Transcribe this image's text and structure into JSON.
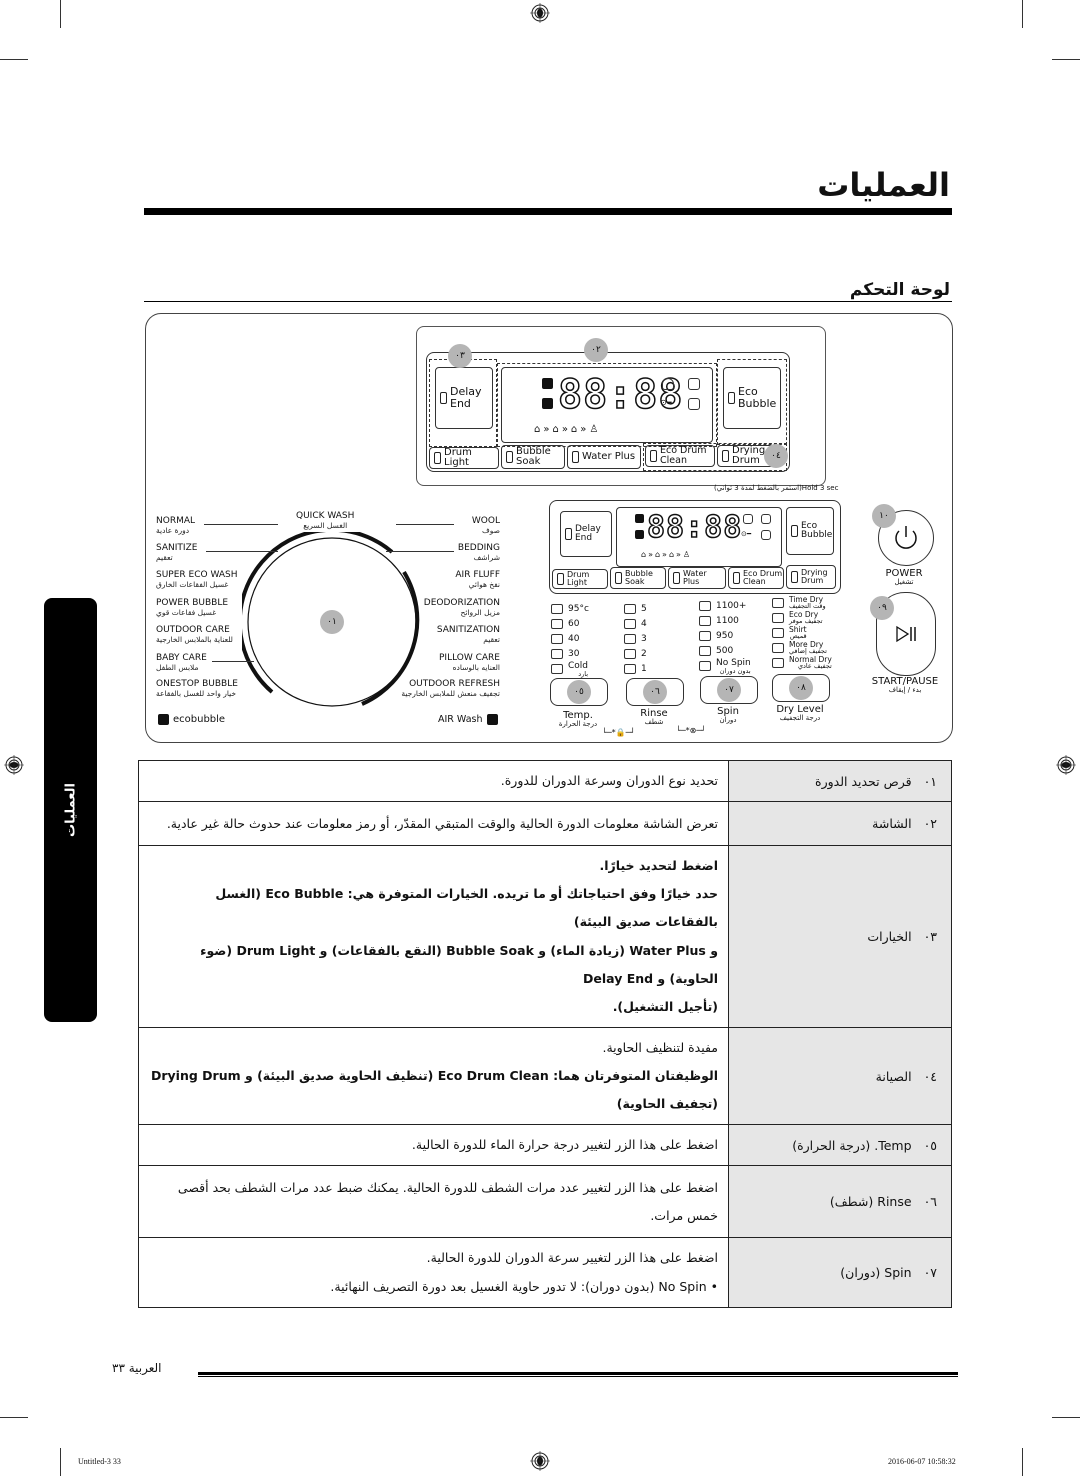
{
  "header": {
    "title": "العمليات",
    "section_title": "لوحة التحكم"
  },
  "side_tab": {
    "label": "العمليات"
  },
  "panel": {
    "upper_display": {
      "digits": "88:88",
      "buttons": {
        "delay_end": "Delay End",
        "eco_bubble": "Eco Bubble",
        "drum_light": "Drum Light",
        "bubble_soak": "Bubble Soak",
        "water_plus": "Water Plus",
        "eco_drum_clean": "Eco Drum Clean",
        "drying_drum": "Drying Drum"
      },
      "badges": {
        "b02": "٠٢",
        "b03": "٠٣",
        "b04": "٠٤"
      }
    },
    "hold_note": "(استمر بالضغط لمدة 3 ثواني)Hold 3 sec",
    "dial": {
      "badge": "٠١",
      "top": {
        "en": "QUICK WASH",
        "ar": "الغسل السريع"
      },
      "left": [
        {
          "en": "NORMAL",
          "ar": "دورة عادية"
        },
        {
          "en": "SANITIZE",
          "ar": "تعقيم"
        },
        {
          "en": "SUPER ECO WASH",
          "ar": "غسيل الفقاعات الخارق"
        },
        {
          "en": "POWER BUBBLE",
          "ar": "غسيل فقاعات قوي"
        },
        {
          "en": "OUTDOOR CARE",
          "ar": "للعناية بالملابس الخارجية"
        },
        {
          "en": "BABY CARE",
          "ar": "ملابس الطفل"
        },
        {
          "en": "ONESTOP BUBBLE",
          "ar": "خيار واحد للغسل بالفقاعة"
        }
      ],
      "right": [
        {
          "en": "WOOL",
          "ar": "صوف"
        },
        {
          "en": "BEDDING",
          "ar": "شراشف"
        },
        {
          "en": "AIR FLUFF",
          "ar": "نفخ هوائي"
        },
        {
          "en": "DEODORIZATION",
          "ar": "مزيل الروائح"
        },
        {
          "en": "SANITIZATION",
          "ar": "تعقيم"
        },
        {
          "en": "PILLOW CARE",
          "ar": "العنايه بالوساده"
        },
        {
          "en": "OUTDOOR REFRESH",
          "ar": "تجفيف منعش للملابس الخارجية"
        }
      ],
      "logo_left": "ecobubble",
      "logo_right": "AIR Wash"
    },
    "lower_display": {
      "digits": "88:88",
      "buttons": {
        "delay_end": "Delay End",
        "eco_bubble": "Eco Bubble",
        "drum_light": "Drum Light",
        "bubble_soak": "Bubble Soak",
        "water_plus": "Water Plus",
        "eco_drum_clean": "Eco Drum Clean",
        "drying_drum": "Drying Drum"
      }
    },
    "temp_options": [
      "95°c",
      "60",
      "40",
      "30"
    ],
    "temp_cold": {
      "en": "Cold",
      "ar": "بارد"
    },
    "rinse_options": [
      "5",
      "4",
      "3",
      "2",
      "1"
    ],
    "spin_options": [
      "1100+",
      "1100",
      "950",
      "500"
    ],
    "spin_nospin": {
      "en": "No Spin",
      "ar": "بدون دوران"
    },
    "dry_options": [
      {
        "en": "Time Dry",
        "ar": "وقت التجفيف"
      },
      {
        "en": "Eco Dry",
        "ar": "تجفيف موفر"
      },
      {
        "en": "Shirt",
        "ar": "قميص"
      },
      {
        "en": "More Dry",
        "ar": "تجفيف إضافي"
      },
      {
        "en": "Normal Dry",
        "ar": "تجفيف عادي"
      }
    ],
    "selectors": [
      {
        "badge": "٠٥",
        "en": "Temp.",
        "ar": "درجة الحرارة"
      },
      {
        "badge": "٠٦",
        "en": "Rinse",
        "ar": "شطف"
      },
      {
        "badge": "٠٧",
        "en": "Spin",
        "ar": "دوران"
      },
      {
        "badge": "٠٨",
        "en": "Dry Level",
        "ar": "درجة التجفيف"
      }
    ],
    "power": {
      "badge": "١٠",
      "en": "POWER",
      "ar": "تشغيل"
    },
    "start_pause": {
      "badge": "٠٩",
      "en": "START/PAUSE",
      "ar": "بدء / إيقاف"
    }
  },
  "table": {
    "rows": [
      {
        "num": "٠١",
        "name": "قرص تحديد الدورة",
        "desc": [
          "تحديد نوع الدوران وسرعة الدوران للدورة."
        ]
      },
      {
        "num": "٠٢",
        "name": "الشاشة",
        "desc": [
          "تعرض الشاشة معلومات الدورة الحالية والوقت المتبقي المقدّر، أو رمز معلومات عند حدوث حالة غير عادية."
        ]
      },
      {
        "num": "٠٣",
        "name": "الخيارات",
        "desc": [
          "اضغط لتحديد خيارًا.",
          "حدد خيارًا وفق احتياجاتك أو ما تريده. الخيارات المتوفرة هي: Eco Bubble (الغسل بالفقاعات صديق البيئة)",
          "و Water Plus (زيادة الماء) و Bubble Soak (النقع بالفقاعات) و Drum Light (ضوء الحاوية) و Delay End",
          "(تأجيل التشغيل)."
        ]
      },
      {
        "num": "٠٤",
        "name": "الصيانة",
        "desc": [
          "مفيدة لتنظيف الحاوية.",
          "الوظيفتان المتوفرتان هما: Eco Drum Clean (تنظيف الحاوية صديق البيئة) و Drying Drum (تجفيف الحاوية)"
        ]
      },
      {
        "num": "٠٥",
        "name": "Temp. (درجة الحرارة)",
        "desc": [
          "اضغط على هذا الزر لتغيير درجة حرارة الماء للدورة الحالية."
        ]
      },
      {
        "num": "٠٦",
        "name": "Rinse (شطف)",
        "desc": [
          "اضغط على هذا الزر لتغيير عدد مرات الشطف للدورة الحالية. يمكنك ضبط عدد مرات الشطف بحد أقصى",
          "خمس مرات."
        ]
      },
      {
        "num": "٠٧",
        "name": "Spin (دوران)",
        "desc": [
          "اضغط على هذا الزر لتغيير سرعة الدوران للدورة الحالية.",
          "•   No Spin (بدون دوران): لا تدور حاوية الغسيل بعد دورة التصريف النهائية."
        ]
      }
    ]
  },
  "footer": {
    "page_label": "العربية ٣٣",
    "imprint_left": "Untitled-3   33",
    "imprint_right": "2016-06-07   10:58:32"
  }
}
